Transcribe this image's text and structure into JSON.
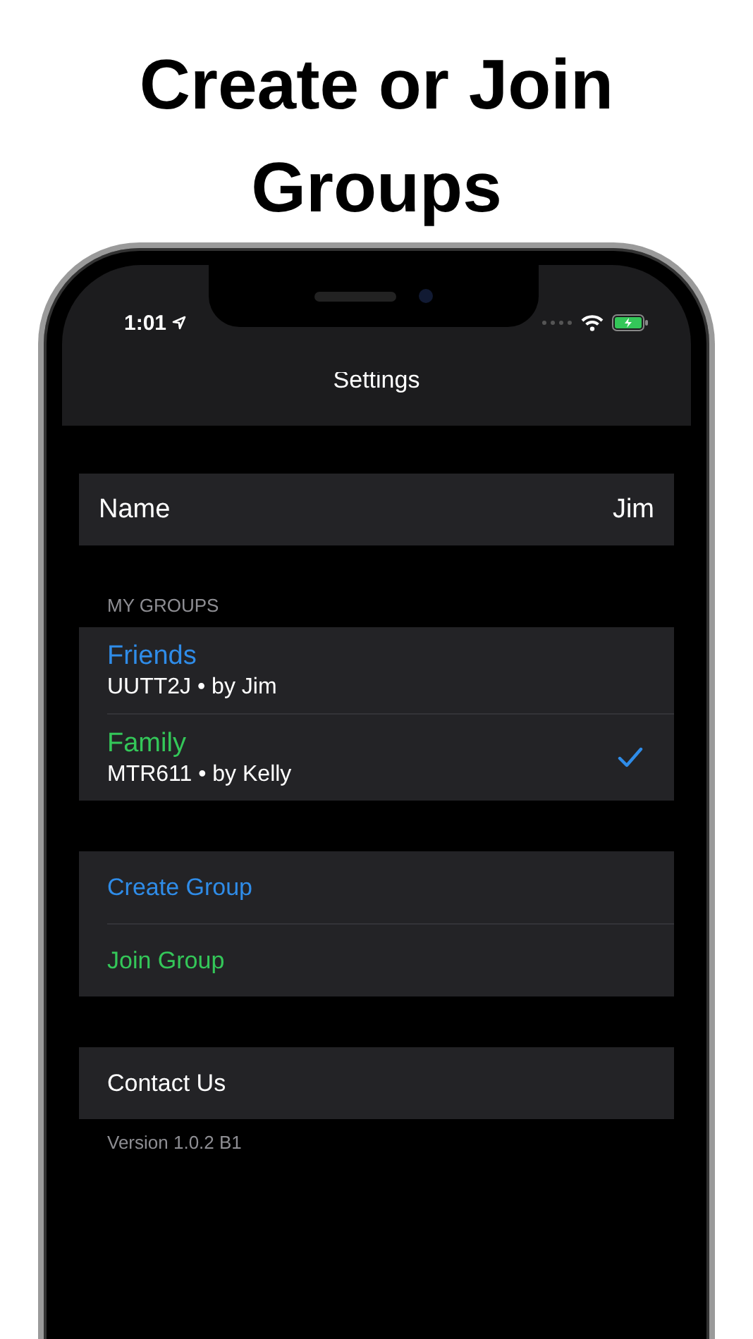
{
  "headline": "Create or Join Groups",
  "status_bar": {
    "time": "1:01"
  },
  "nav": {
    "title": "Settings"
  },
  "profile": {
    "label": "Name",
    "value": "Jim"
  },
  "groups": {
    "header": "MY GROUPS",
    "items": [
      {
        "name": "Friends",
        "detail": "UUTT2J • by Jim",
        "color": "#2f8ce8",
        "selected": false
      },
      {
        "name": "Family",
        "detail": "MTR611 • by Kelly",
        "color": "#34c759",
        "selected": true
      }
    ]
  },
  "actions": [
    {
      "label": "Create Group",
      "color": "#2f8ce8"
    },
    {
      "label": "Join Group",
      "color": "#34c759"
    }
  ],
  "contact": {
    "label": "Contact Us"
  },
  "version": "Version 1.0.2 B1"
}
